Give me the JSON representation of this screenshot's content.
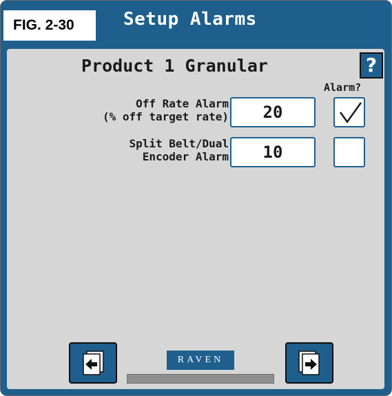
{
  "figure_label": "FIG. 2-30",
  "window": {
    "title": "Setup Alarms"
  },
  "panel": {
    "title": "Product 1 Granular",
    "help_label": "?",
    "column_header": "Alarm?",
    "rows": [
      {
        "label": "Off Rate Alarm\n(% off target rate)",
        "value": "20",
        "alarm_checked": true
      },
      {
        "label": "Split Belt/Dual\nEncoder Alarm",
        "value": "10",
        "alarm_checked": false
      }
    ]
  },
  "footer": {
    "brand": "RAVEN",
    "back_button": "back-page-icon",
    "next_button": "next-page-icon",
    "progress": 0
  },
  "colors": {
    "accent": "#1f5f8d",
    "panel_bg": "#d6d6d6"
  }
}
